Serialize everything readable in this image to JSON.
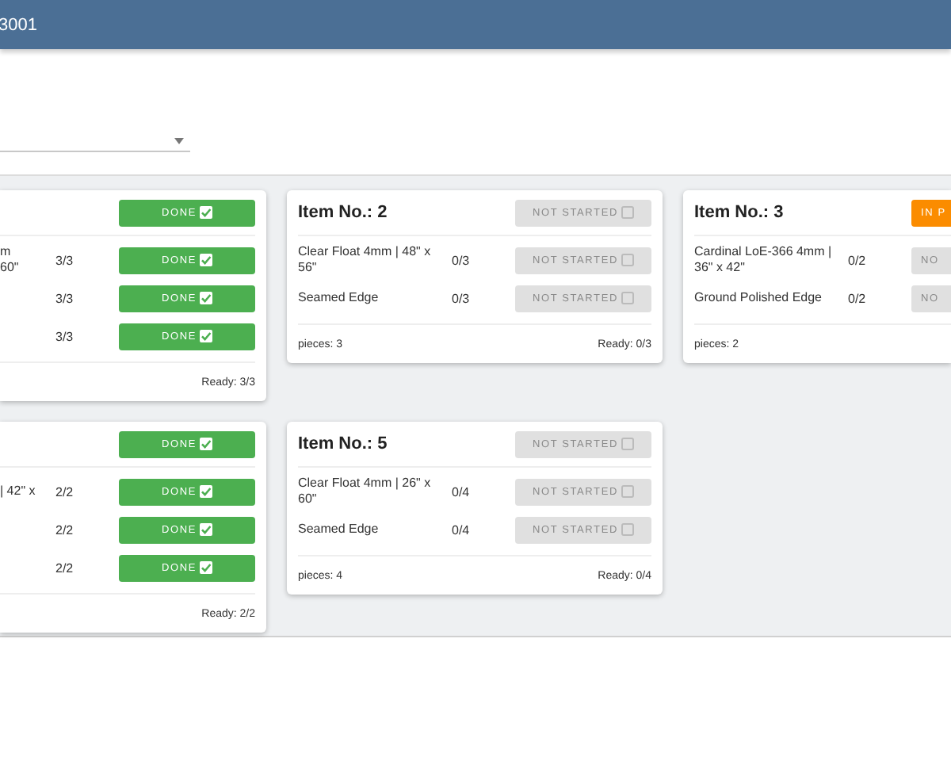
{
  "header": {
    "title": "3001"
  },
  "cards": [
    {
      "kind": "cut_left",
      "status": {
        "label": "DONE",
        "kind": "done"
      },
      "items": [
        {
          "name": "m\n60\"",
          "count": "3/3",
          "status": {
            "label": "DONE",
            "kind": "done"
          }
        },
        {
          "count": "3/3",
          "status": {
            "label": "DONE",
            "kind": "done"
          }
        },
        {
          "count": "3/3",
          "status": {
            "label": "DONE",
            "kind": "done"
          }
        }
      ],
      "ready": "Ready: 3/3"
    },
    {
      "kind": "full",
      "title": "Item No.: 2",
      "status": {
        "label": "NOT STARTED",
        "kind": "not_started"
      },
      "items": [
        {
          "name": "Clear Float 4mm | 48\" x 56\"",
          "count": "0/3",
          "status": {
            "label": "NOT STARTED",
            "kind": "not_started"
          }
        },
        {
          "name": "Seamed Edge",
          "count": "0/3",
          "status": {
            "label": "NOT STARTED",
            "kind": "not_started"
          }
        }
      ],
      "pieces": "pieces: 3",
      "ready": "Ready: 0/3"
    },
    {
      "kind": "cut_right",
      "title": "Item No.: 3",
      "status": {
        "label": "IN P",
        "kind": "in_progress"
      },
      "items": [
        {
          "name": "Cardinal LoE-366 4mm | 36\" x 42\"",
          "count": "0/2",
          "status": {
            "label": "NO",
            "kind": "not_started"
          }
        },
        {
          "name": "Ground Polished Edge",
          "count": "0/2",
          "status": {
            "label": "NO",
            "kind": "not_started"
          }
        }
      ],
      "pieces": "pieces: 2"
    },
    {
      "kind": "cut_left",
      "status": {
        "label": "DONE",
        "kind": "done"
      },
      "items": [
        {
          "name": "| 42\" x",
          "count": "2/2",
          "status": {
            "label": "DONE",
            "kind": "done"
          }
        },
        {
          "count": "2/2",
          "status": {
            "label": "DONE",
            "kind": "done"
          }
        },
        {
          "count": "2/2",
          "status": {
            "label": "DONE",
            "kind": "done"
          }
        }
      ],
      "ready": "Ready: 2/2"
    },
    {
      "kind": "full",
      "title": "Item No.: 5",
      "status": {
        "label": "NOT STARTED",
        "kind": "not_started"
      },
      "items": [
        {
          "name": "Clear Float 4mm | 26\" x 60\"",
          "count": "0/4",
          "status": {
            "label": "NOT STARTED",
            "kind": "not_started"
          }
        },
        {
          "name": "Seamed Edge",
          "count": "0/4",
          "status": {
            "label": "NOT STARTED",
            "kind": "not_started"
          }
        }
      ],
      "pieces": "pieces: 4",
      "ready": "Ready: 0/4"
    }
  ]
}
